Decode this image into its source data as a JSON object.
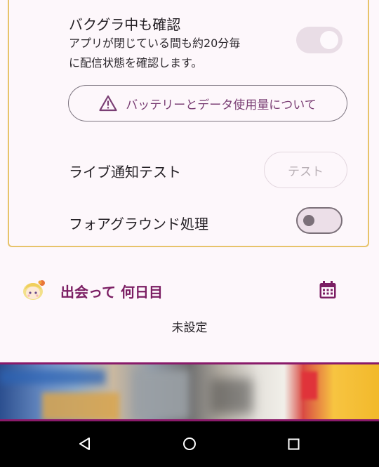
{
  "settings": {
    "background_check": {
      "title": "バクグラ中も確認",
      "description_line1": "アプリが閉じている間も約20分毎",
      "description_line2": "に配信状態を確認します。",
      "enabled": true
    },
    "battery_button_label": "バッテリーとデータ使用量について",
    "live_test": {
      "label": "ライブ通知テスト",
      "button_label": "テスト"
    },
    "foreground": {
      "label": "フォアグラウンド処理",
      "enabled": false
    }
  },
  "meeting": {
    "title": "出会って 何日目",
    "value": "未設定"
  },
  "colors": {
    "accent": "#7b1e63",
    "card_border": "#e7c36a",
    "background": "#fdf7fb"
  },
  "nav": {
    "back_icon": "back-triangle-icon",
    "home_icon": "home-circle-icon",
    "recent_icon": "recent-square-icon"
  }
}
